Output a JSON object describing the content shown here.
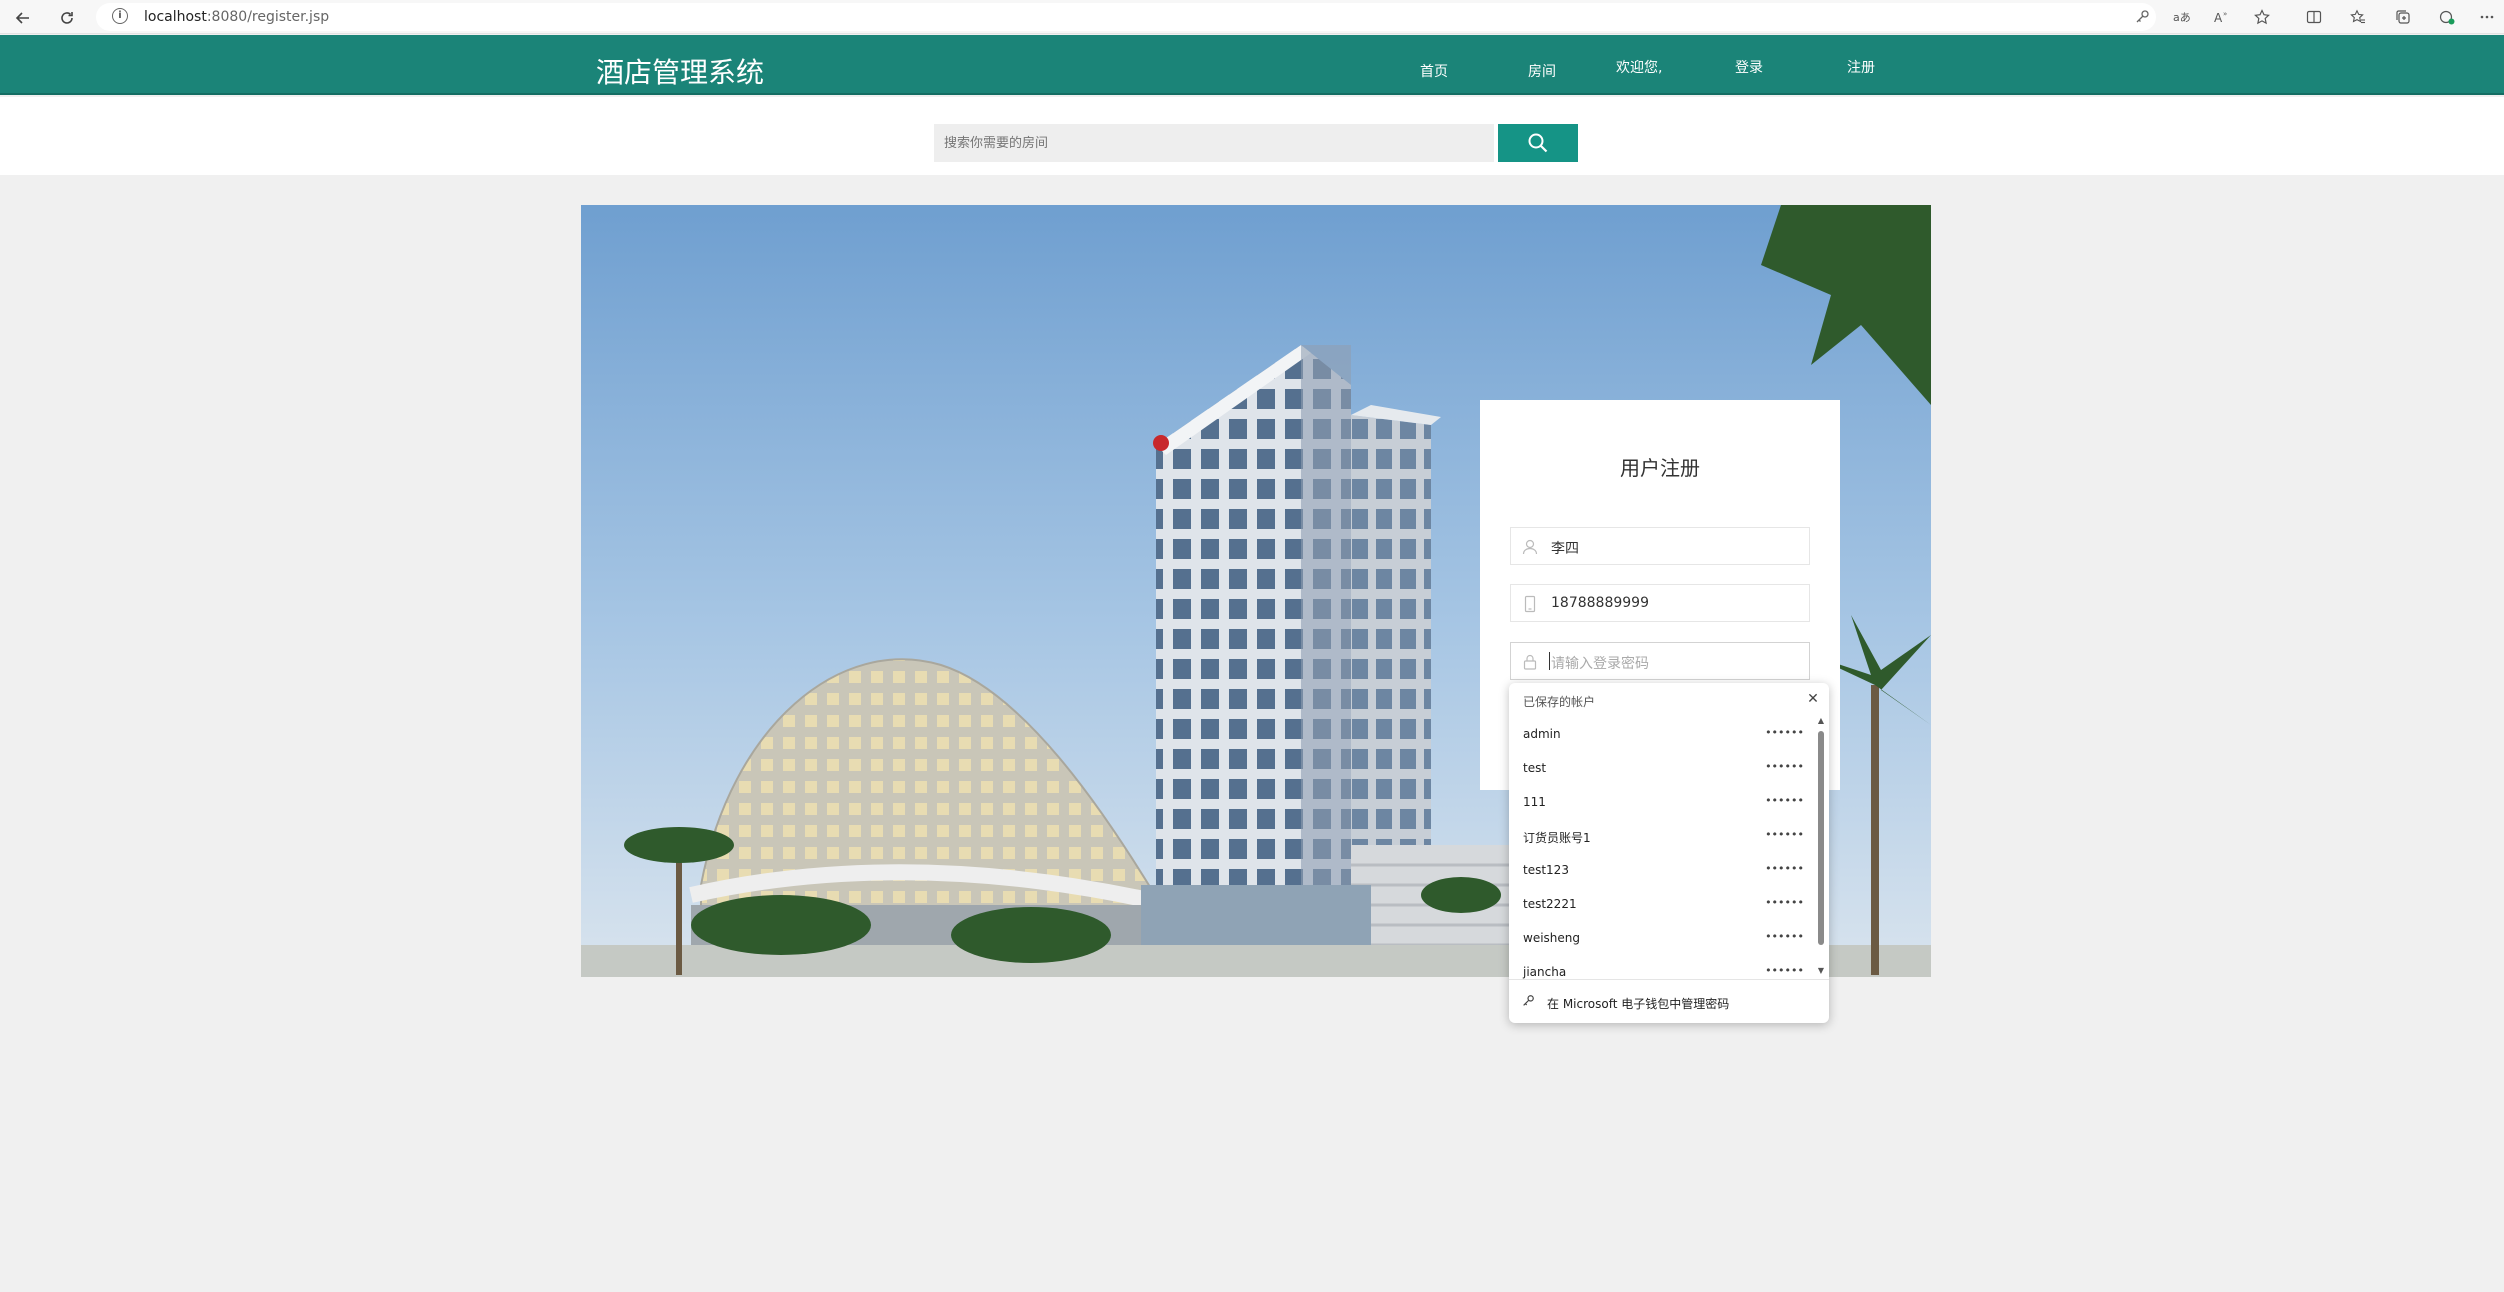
{
  "browser": {
    "url_host": "localhost",
    "url_rest": ":8080/register.jsp",
    "icons": {
      "back": "back-arrow-icon",
      "reload": "reload-icon",
      "info": "info-icon",
      "key": "key-icon",
      "translate": "translate-icon",
      "read_aloud": "read-aloud-icon",
      "favorite": "star-icon",
      "split": "split-screen-icon",
      "favorites": "favorites-icon",
      "collections": "collections-icon",
      "extensions": "extensions-icon",
      "more": "more-icon"
    }
  },
  "header": {
    "brand": "酒店管理系统",
    "nav": [
      "首页",
      "房间",
      "欢迎您,",
      "登录",
      "注册"
    ],
    "color": "#1b8478"
  },
  "search": {
    "placeholder": "搜索你需要的房间",
    "button_icon": "search-icon",
    "button_color": "#159486"
  },
  "register": {
    "title": "用户注册",
    "username": "李四",
    "phone": "18788889999",
    "password_placeholder": "请输入登录密码"
  },
  "saved_accounts": {
    "title": "已保存的帐户",
    "accounts": [
      {
        "name": "admin",
        "password": "••••••"
      },
      {
        "name": "test",
        "password": "••••••"
      },
      {
        "name": "111",
        "password": "••••••"
      },
      {
        "name": "订货员账号1",
        "password": "••••••"
      },
      {
        "name": "test123",
        "password": "••••••"
      },
      {
        "name": "test2221",
        "password": "••••••"
      },
      {
        "name": "weisheng",
        "password": "••••••"
      },
      {
        "name": "jiancha",
        "password": "••••••"
      }
    ],
    "footer": "在 Microsoft 电子钱包中管理密码"
  }
}
